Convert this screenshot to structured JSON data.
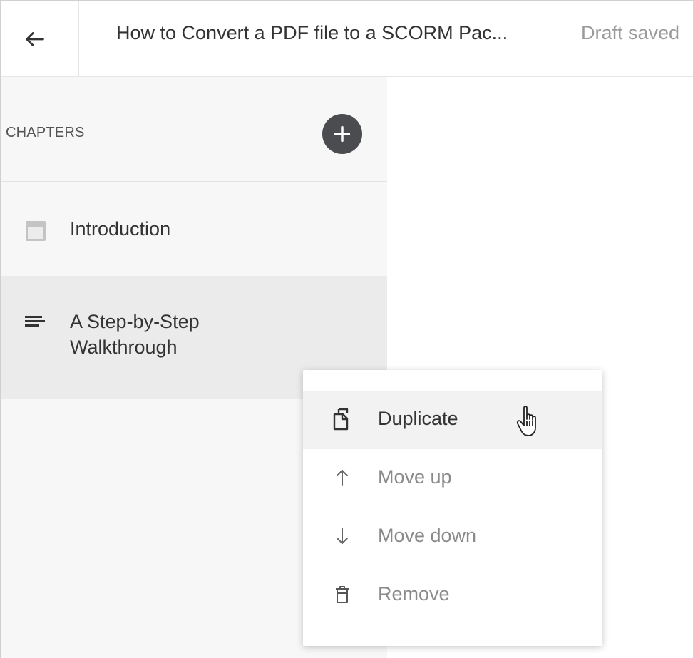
{
  "header": {
    "title": "How to Convert a PDF file to a SCORM Pac...",
    "status": "Draft saved"
  },
  "sidebar": {
    "heading": "CHAPTERS",
    "chapters": [
      {
        "label": "Introduction",
        "icon": "page-layout-icon"
      },
      {
        "label": "A Step-by-Step Walkthrough",
        "icon": "lines-icon"
      }
    ]
  },
  "context_menu": {
    "items": [
      {
        "label": "Duplicate",
        "icon": "duplicate-icon",
        "state": "hover"
      },
      {
        "label": "Move up",
        "icon": "arrow-up-icon",
        "state": "normal"
      },
      {
        "label": "Move down",
        "icon": "arrow-down-icon",
        "state": "normal"
      },
      {
        "label": "Remove",
        "icon": "trash-icon",
        "state": "normal"
      }
    ]
  },
  "colors": {
    "sidebar_bg": "#f7f7f7",
    "selected_bg": "#ebebeb",
    "add_button": "#4a4c50",
    "muted_text": "#9a9a9a"
  }
}
